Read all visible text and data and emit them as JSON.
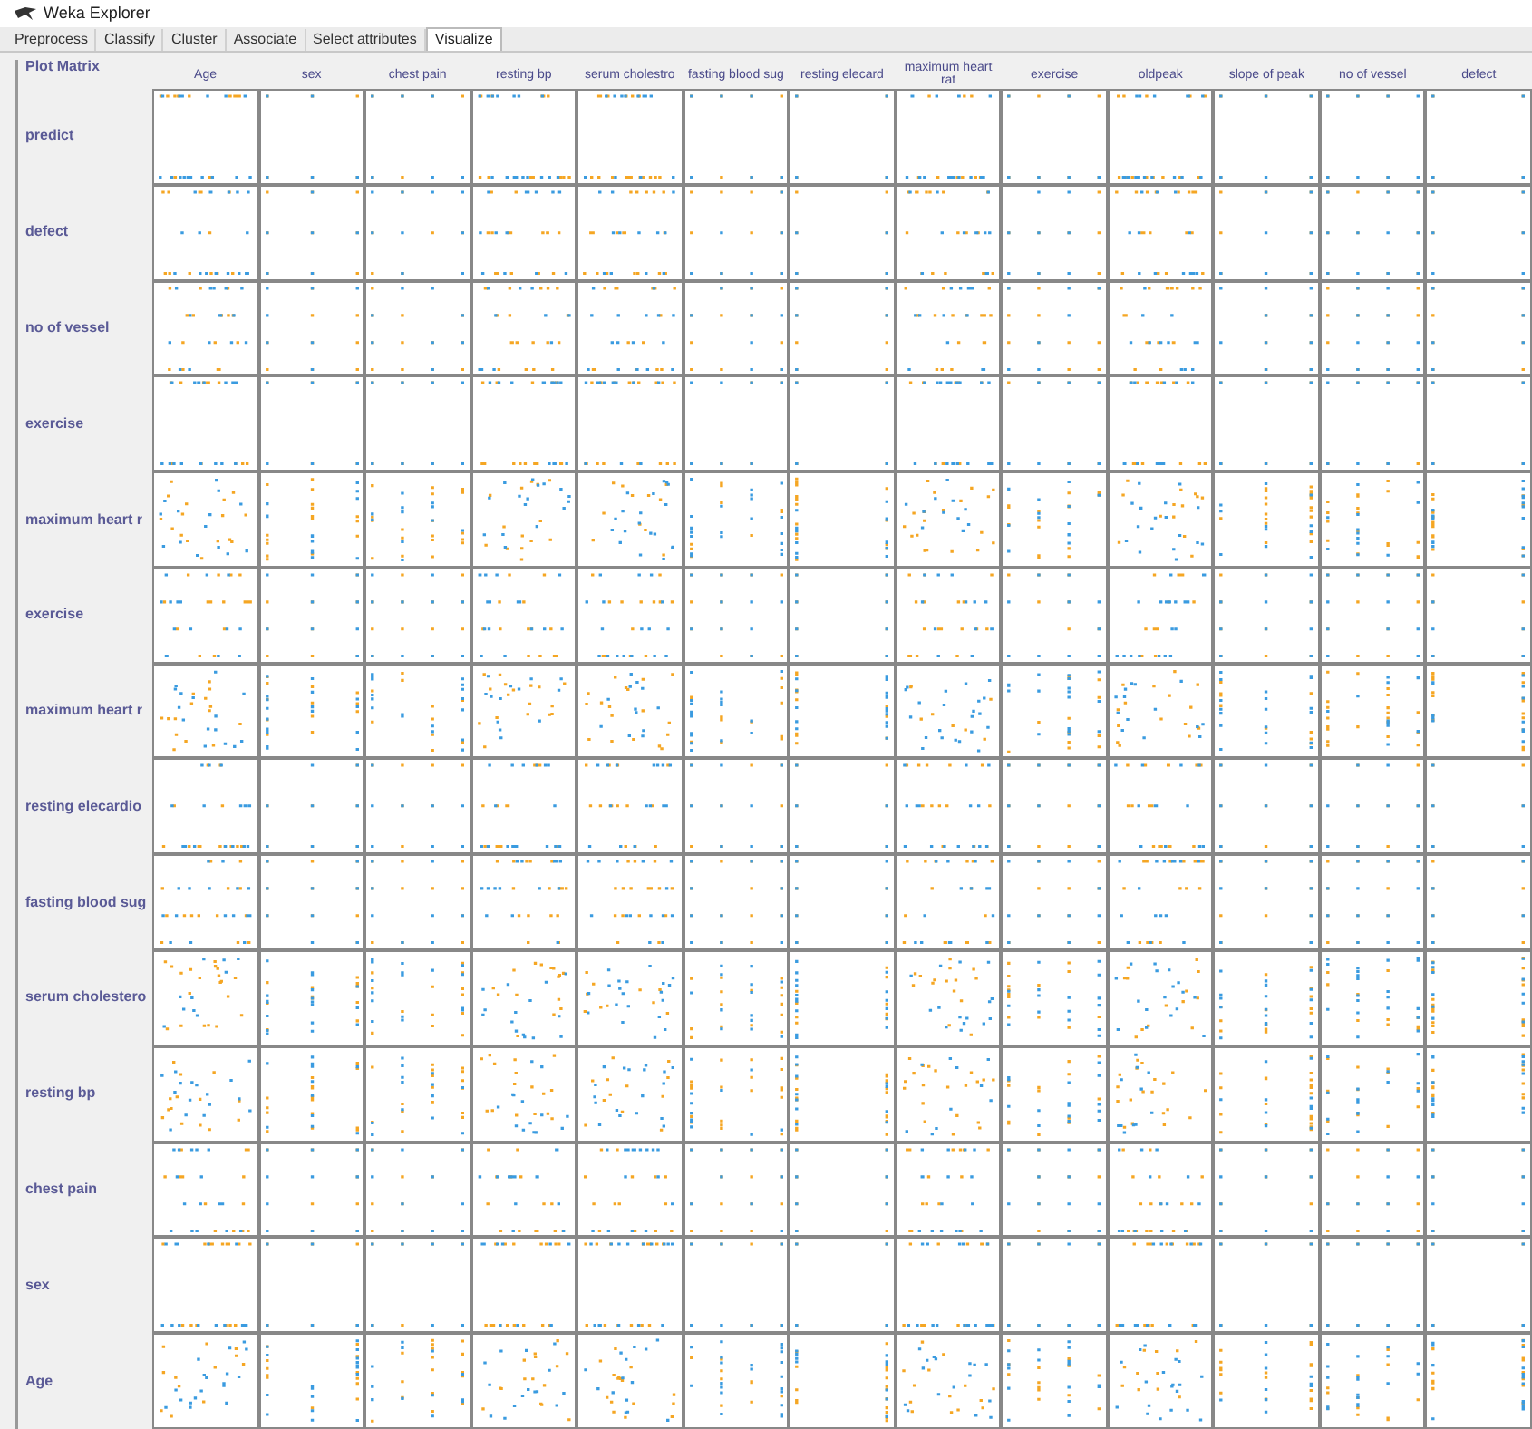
{
  "window": {
    "title": "Weka Explorer"
  },
  "tabs": [
    {
      "label": "Preprocess",
      "selected": false
    },
    {
      "label": "Classify",
      "selected": false
    },
    {
      "label": "Cluster",
      "selected": false
    },
    {
      "label": "Associate",
      "selected": false
    },
    {
      "label": "Select attributes",
      "selected": false
    },
    {
      "label": "Visualize",
      "selected": true
    }
  ],
  "plot_matrix": {
    "title": "Plot Matrix",
    "columns": [
      {
        "label": "Age",
        "kind": "numeric"
      },
      {
        "label": "sex",
        "kind": "nominal"
      },
      {
        "label": "chest pain",
        "kind": "nominal"
      },
      {
        "label": "resting bp",
        "kind": "numeric"
      },
      {
        "label": "serum cholestro",
        "kind": "numeric"
      },
      {
        "label": "fasting blood sug",
        "kind": "nominal"
      },
      {
        "label": "resting elecard",
        "kind": "nominal"
      },
      {
        "label": "maximum heart rat",
        "kind": "numeric"
      },
      {
        "label": "exercise",
        "kind": "nominal"
      },
      {
        "label": "oldpeak",
        "kind": "numeric"
      },
      {
        "label": "slope of peak",
        "kind": "nominal"
      },
      {
        "label": "no of vessel",
        "kind": "nominal"
      },
      {
        "label": "defect",
        "kind": "nominal"
      }
    ],
    "rows": [
      {
        "label": "predict",
        "kind": "nominal"
      },
      {
        "label": "defect",
        "kind": "nominal"
      },
      {
        "label": "no of vessel",
        "kind": "nominal"
      },
      {
        "label": "exercise",
        "kind": "nominal"
      },
      {
        "label": "maximum heart r",
        "kind": "numeric"
      },
      {
        "label": "exercise",
        "kind": "nominal"
      },
      {
        "label": "maximum heart r",
        "kind": "numeric"
      },
      {
        "label": "resting elecardio",
        "kind": "nominal"
      },
      {
        "label": "fasting blood sug",
        "kind": "nominal"
      },
      {
        "label": "serum cholestero",
        "kind": "numeric"
      },
      {
        "label": "resting bp",
        "kind": "numeric"
      },
      {
        "label": "chest pain",
        "kind": "nominal"
      },
      {
        "label": "sex",
        "kind": "nominal"
      },
      {
        "label": "Age",
        "kind": "numeric"
      }
    ]
  }
}
